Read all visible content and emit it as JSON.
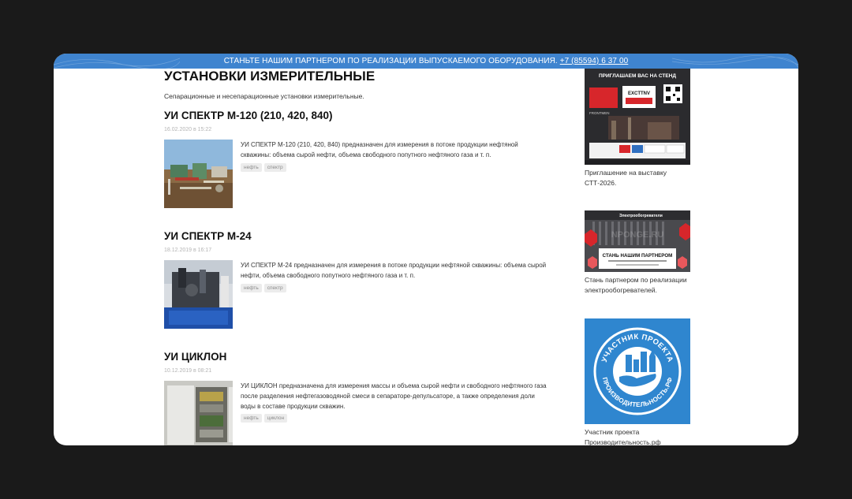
{
  "topbar": {
    "text": "СТАНЬТЕ НАШИМ ПАРТНЕРОМ ПО РЕАЛИЗАЦИИ ВЫПУСКАЕМОГО ОБОРУДОВАНИЯ.",
    "phone": "+7 (85594) 6 37 00"
  },
  "page": {
    "title": "УСТАНОВКИ ИЗМЕРИТЕЛЬНЫЕ",
    "description": "Сепарационные и несепарационные установки измерительные."
  },
  "articles": [
    {
      "title": "УИ СПЕКТР М-120 (210, 420, 840)",
      "date": "16.02.2020 в 15:22",
      "text": "УИ СПЕКТР М-120 (210, 420, 840) предназначен для измерения в потоке продукции нефтяной скважины: объема сырой нефти, объема свободного попутного нефтяного газа и т. п.",
      "tags": [
        "нефть",
        "спектр"
      ]
    },
    {
      "title": "УИ СПЕКТР М-24",
      "date": "18.12.2019 в 16:17",
      "text": "УИ СПЕКТР М-24 предназначен для измерения в потоке продукции нефтяной скважины: объема сырой нефти, объема свободного попутного нефтяного газа и т. п.",
      "tags": [
        "нефть",
        "спектр"
      ]
    },
    {
      "title": "УИ ЦИКЛОН",
      "date": "10.12.2019 в 08:21",
      "text": "УИ ЦИКЛОН предназначена для измерения массы и объема сырой нефти и свободного нефтяного газа после разделения нефтегазоводяной смеси в сепараторе-депульсаторе, а также определения доли воды в составе продукции скважин.",
      "tags": [
        "нефть",
        "циклон"
      ]
    }
  ],
  "sidebar": {
    "cards": [
      {
        "caption": "Приглашение на выставку СТТ-2026.",
        "banner": {
          "headline": "ПРИГЛАШАЕМ ВАС НА СТЕНД",
          "code": "EXCTTNV",
          "brand": "FRONTMEN"
        }
      },
      {
        "caption": "Стань партнером по реализации электрообогревателей.",
        "banner": {
          "headline": "Электрообогреватели",
          "watermark": "NPONGE.RU",
          "cta": "СТАНЬ НАШИМ ПАРТНЕРОМ"
        }
      },
      {
        "caption": "Участник проекта Производительность.рф",
        "banner": {
          "ring_top": "УЧАСТНИК ПРОЕКТА",
          "ring_bottom": "ПРОИЗВОДИТЕЛЬНОСТЬ.РФ"
        }
      }
    ]
  },
  "colors": {
    "background": "#1a1a1a",
    "topbar": "#3f84cf",
    "badge_blue": "#2f86cf"
  }
}
